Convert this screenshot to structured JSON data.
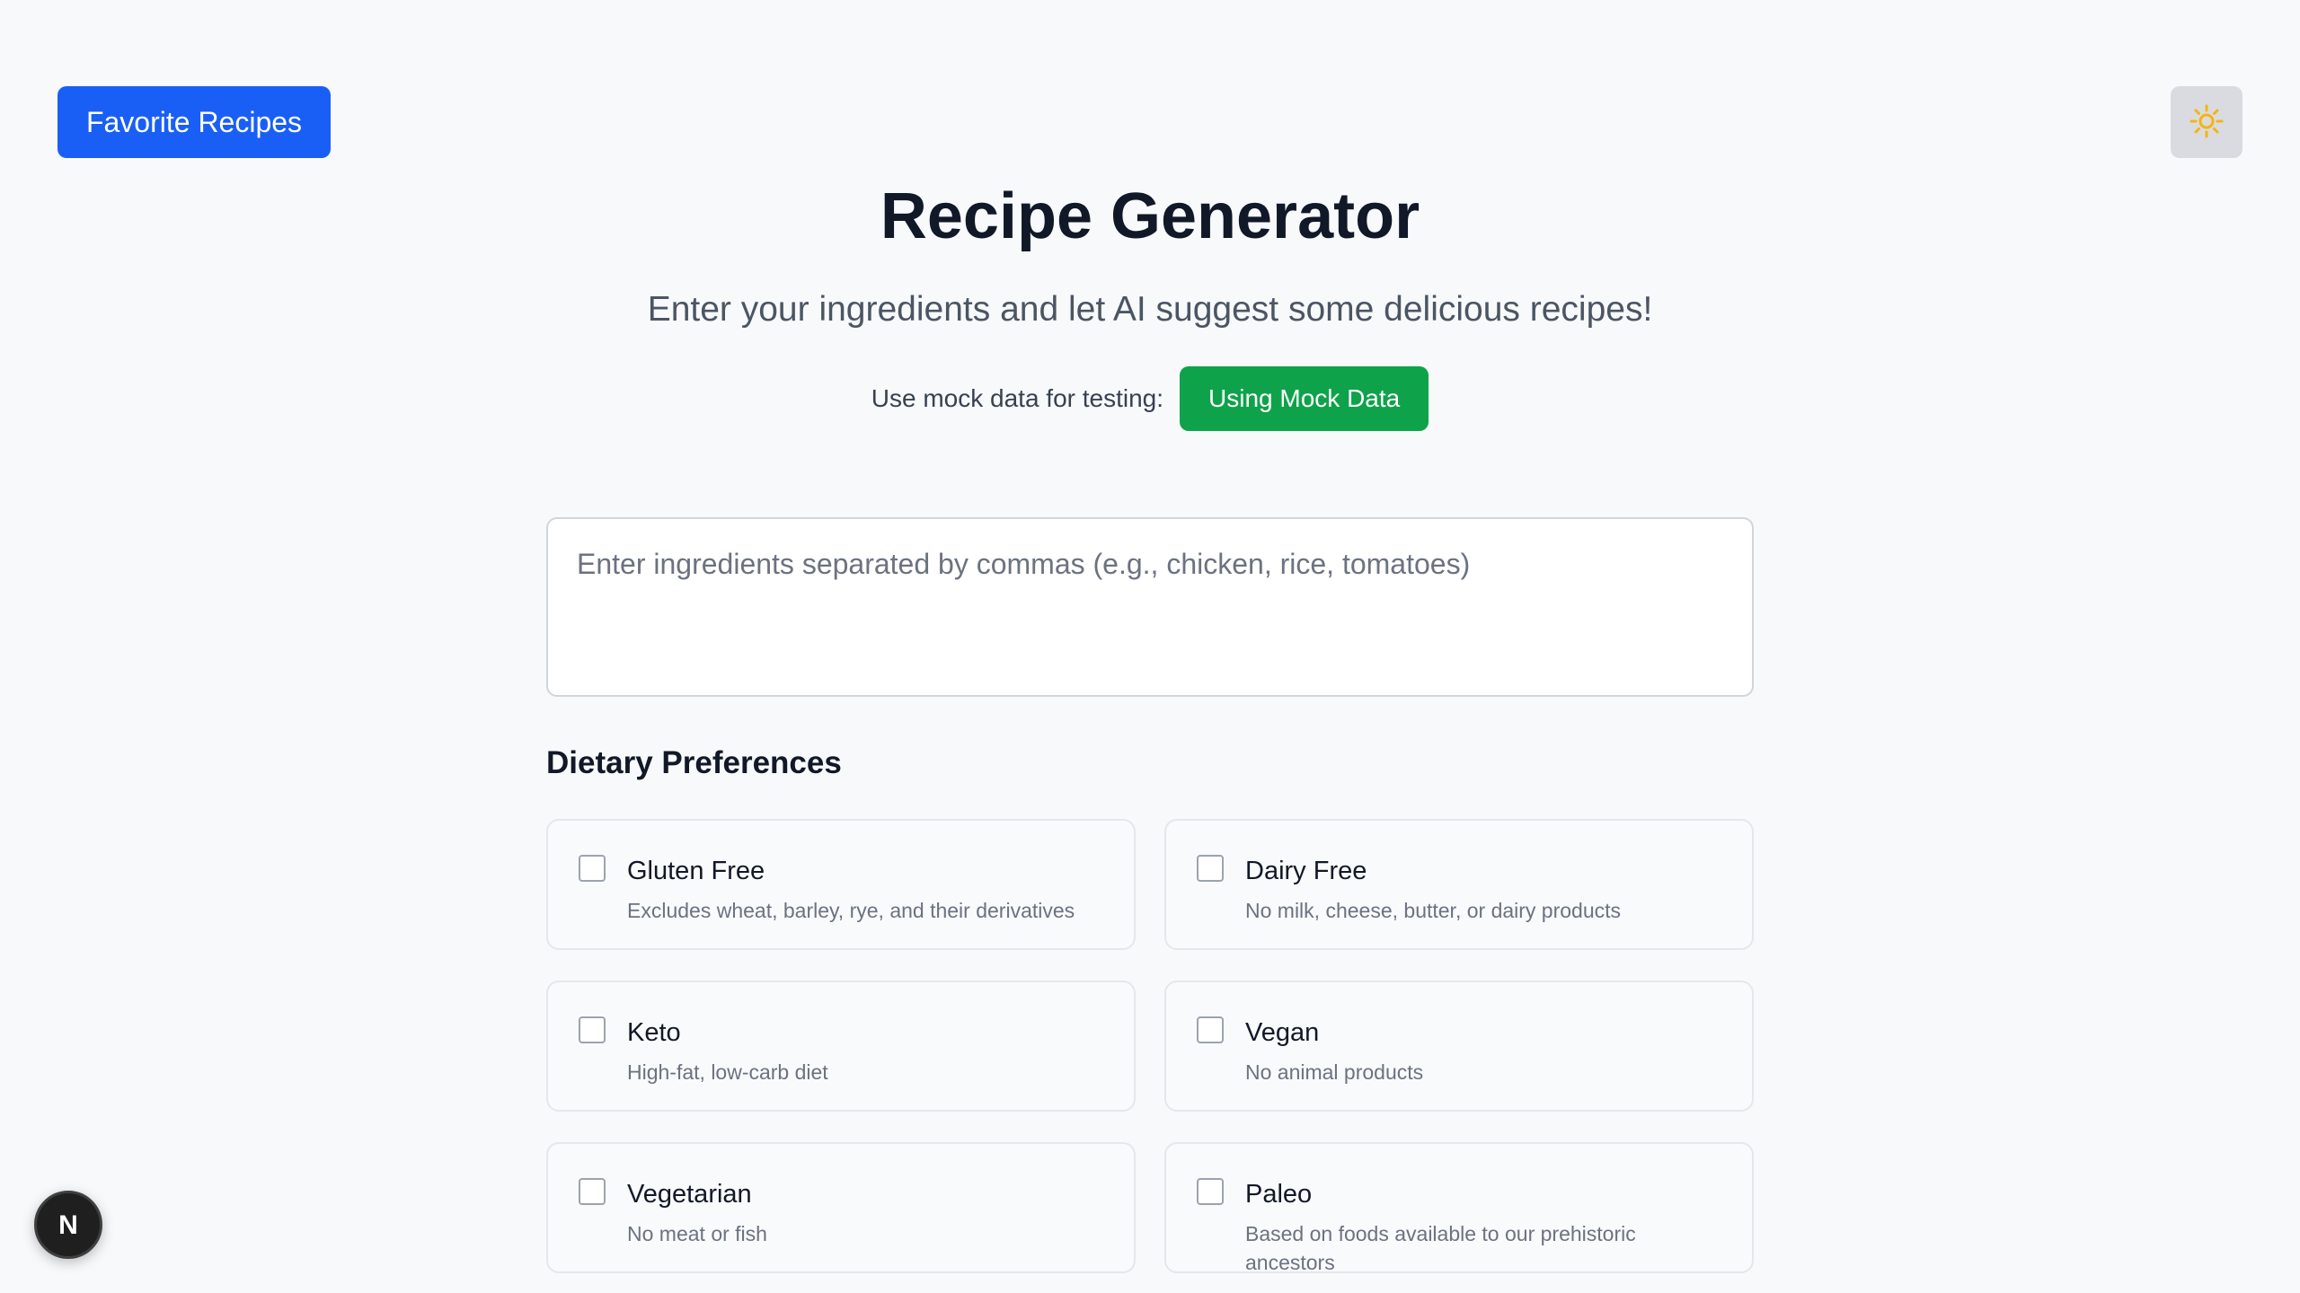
{
  "header": {
    "favorite_label": "Favorite Recipes",
    "theme_icon": "sun-icon"
  },
  "hero": {
    "title": "Recipe Generator",
    "subtitle": "Enter your ingredients and let AI suggest some delicious recipes!",
    "mock_label": "Use mock data for testing:",
    "mock_button": "Using Mock Data"
  },
  "ingredients": {
    "placeholder": "Enter ingredients separated by commas (e.g., chicken, rice, tomatoes)",
    "value": ""
  },
  "dietary": {
    "heading": "Dietary Preferences",
    "options": [
      {
        "name": "Gluten Free",
        "description": "Excludes wheat, barley, rye, and their derivatives",
        "checked": false
      },
      {
        "name": "Dairy Free",
        "description": "No milk, cheese, butter, or dairy products",
        "checked": false
      },
      {
        "name": "Keto",
        "description": "High-fat, low-carb diet",
        "checked": false
      },
      {
        "name": "Vegan",
        "description": "No animal products",
        "checked": false
      },
      {
        "name": "Vegetarian",
        "description": "No meat or fish",
        "checked": false
      },
      {
        "name": "Paleo",
        "description": "Based on foods available to our prehistoric ancestors",
        "checked": false
      }
    ]
  },
  "colors": {
    "primary": "#1a5ff5",
    "success": "#0ea34a",
    "background": "#f8f9fb",
    "sun": "#f5b40f"
  },
  "badge": {
    "letter": "N",
    "icon": "nextjs-logo-icon"
  }
}
